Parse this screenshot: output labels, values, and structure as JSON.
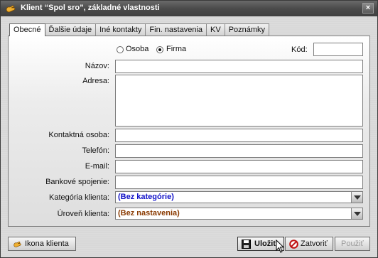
{
  "window": {
    "title": "Klient “Spol sro”, základné vlastnosti",
    "close_glyph": "×"
  },
  "tabs": [
    {
      "label": "Obecné",
      "active": true
    },
    {
      "label": "Ďalšie údaje",
      "active": false
    },
    {
      "label": "Iné kontakty",
      "active": false
    },
    {
      "label": "Fin. nastavenia",
      "active": false
    },
    {
      "label": "KV",
      "active": false
    },
    {
      "label": "Poznámky",
      "active": false
    }
  ],
  "form": {
    "type_options": [
      {
        "label": "Osoba",
        "selected": false
      },
      {
        "label": "Firma",
        "selected": true
      }
    ],
    "code_label": "Kód:",
    "code_value": "",
    "name_label": "Názov:",
    "name_value": "",
    "address_label": "Adresa:",
    "address_value": "",
    "contact_label": "Kontaktná osoba:",
    "contact_value": "",
    "phone_label": "Telefón:",
    "phone_value": "",
    "email_label": "E-mail:",
    "email_value": "",
    "bank_label": "Bankové spojenie:",
    "bank_value": "",
    "category_label": "Kategória klienta:",
    "category_value": "(Bez kategórie)",
    "category_color": "#1010c8",
    "level_label": "Úroveň klienta:",
    "level_value": "(Bez nastavenia)",
    "level_color": "#8a3a00"
  },
  "footer": {
    "client_icon_label": "Ikona klienta",
    "save_label": "Uložiť",
    "close_label": "Zatvoriť",
    "apply_label": "Použiť"
  }
}
